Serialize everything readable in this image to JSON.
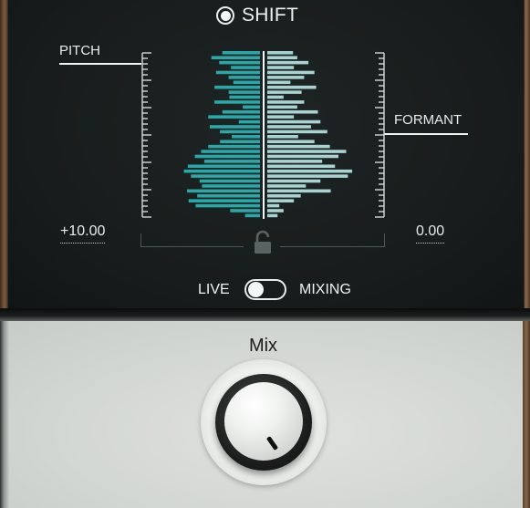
{
  "shift": {
    "label": "SHIFT",
    "selected": true
  },
  "pitch": {
    "label": "PITCH",
    "value": "+10.00"
  },
  "formant": {
    "label": "FORMANT",
    "value": "0.00"
  },
  "mode_toggle": {
    "left_label": "LIVE",
    "right_label": "MIXING",
    "state": "LIVE"
  },
  "mix": {
    "label": "Mix"
  },
  "colors": {
    "pitch_bars": "#2aa7a6",
    "formant_bars": "#a9d3d0",
    "panel_dark": "#181d1d",
    "panel_light": "#d6d9d6"
  },
  "icons": {
    "lock": "unlocked-padlock-icon"
  },
  "histogram": {
    "pitch_levels": [
      0.48,
      0.62,
      0.52,
      0.37,
      0.56,
      0.4,
      0.34,
      0.58,
      0.4,
      0.39,
      0.58,
      0.22,
      0.48,
      0.66,
      0.27,
      0.64,
      0.51,
      0.36,
      0.51,
      0.66,
      0.75,
      0.83,
      0.71,
      0.92,
      0.97,
      0.88,
      0.77,
      0.74,
      0.93,
      0.8,
      0.91,
      0.82,
      0.38,
      0.19
    ],
    "formant_levels": [
      0.3,
      0.35,
      0.48,
      0.31,
      0.55,
      0.43,
      0.27,
      0.57,
      0.4,
      0.19,
      0.43,
      0.35,
      0.59,
      0.31,
      0.62,
      0.51,
      0.7,
      0.36,
      0.55,
      0.73,
      0.92,
      0.83,
      0.64,
      0.79,
      0.99,
      0.94,
      0.62,
      0.45,
      0.74,
      0.39,
      0.31,
      0.14,
      0.19,
      0.12
    ]
  }
}
